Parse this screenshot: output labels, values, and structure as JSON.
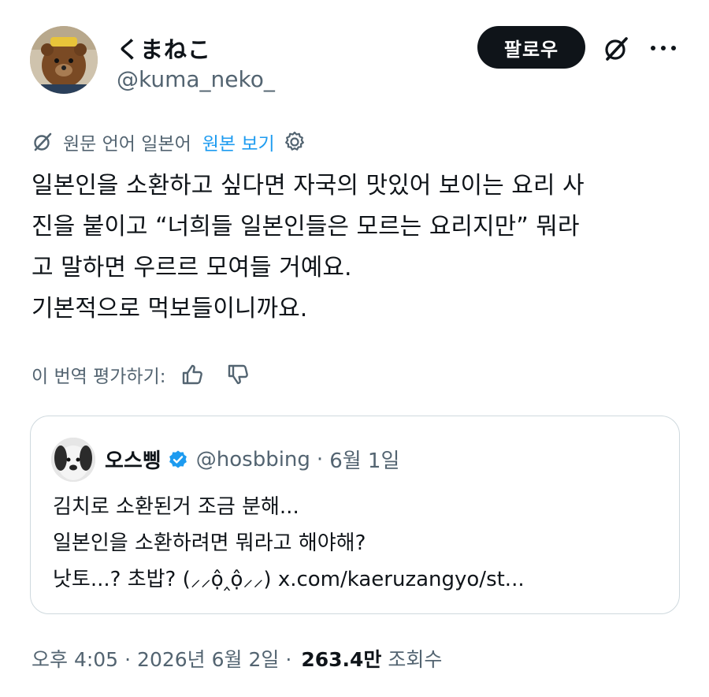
{
  "author": {
    "display_name": "くまねこ",
    "handle": "@kuma_neko_"
  },
  "actions": {
    "follow_label": "팔로우",
    "grok_icon": "grok-icon",
    "more_icon": "more-icon"
  },
  "translation": {
    "source_language": "원문 언어 일본어",
    "show_original": "원본 보기",
    "rate_prompt": "이 번역 평가하기:"
  },
  "tweet": {
    "lines": [
      "일본인을 소환하고 싶다면 자국의 맛있어 보이는 요리 사",
      "진을 붙이고 “너희들 일본인들은 모르는 요리지만” 뭐라",
      "고 말하면 우르르 모여들 거예요.",
      "기본적으로 먹보들이니까요."
    ]
  },
  "quote": {
    "display_name": "오스삥",
    "handle": "@hosbbing",
    "separator": "·",
    "date": "6월 1일",
    "lines": [
      "김치로 소환된거 조금 분해...",
      "일본인을 소환하려면 뭐라고 해야해?"
    ],
    "last_line_text": "낫토...? 초밥? (",
    "emoticon": "⸝⸝ộ‸ộ⸝⸝",
    "emoticon_close": ")",
    "link": "x.com/kaeruzangyo/st..."
  },
  "meta": {
    "time": "오후 4:05",
    "sep1": "·",
    "date": "2026년 6월 2일",
    "sep2": "·",
    "views": "263.4만",
    "views_label": "조회수"
  },
  "colors": {
    "text": "#0f1419",
    "secondary": "#536471",
    "link": "#1d9bf0",
    "border": "#cfd9de",
    "verified": "#1d9bf0"
  }
}
